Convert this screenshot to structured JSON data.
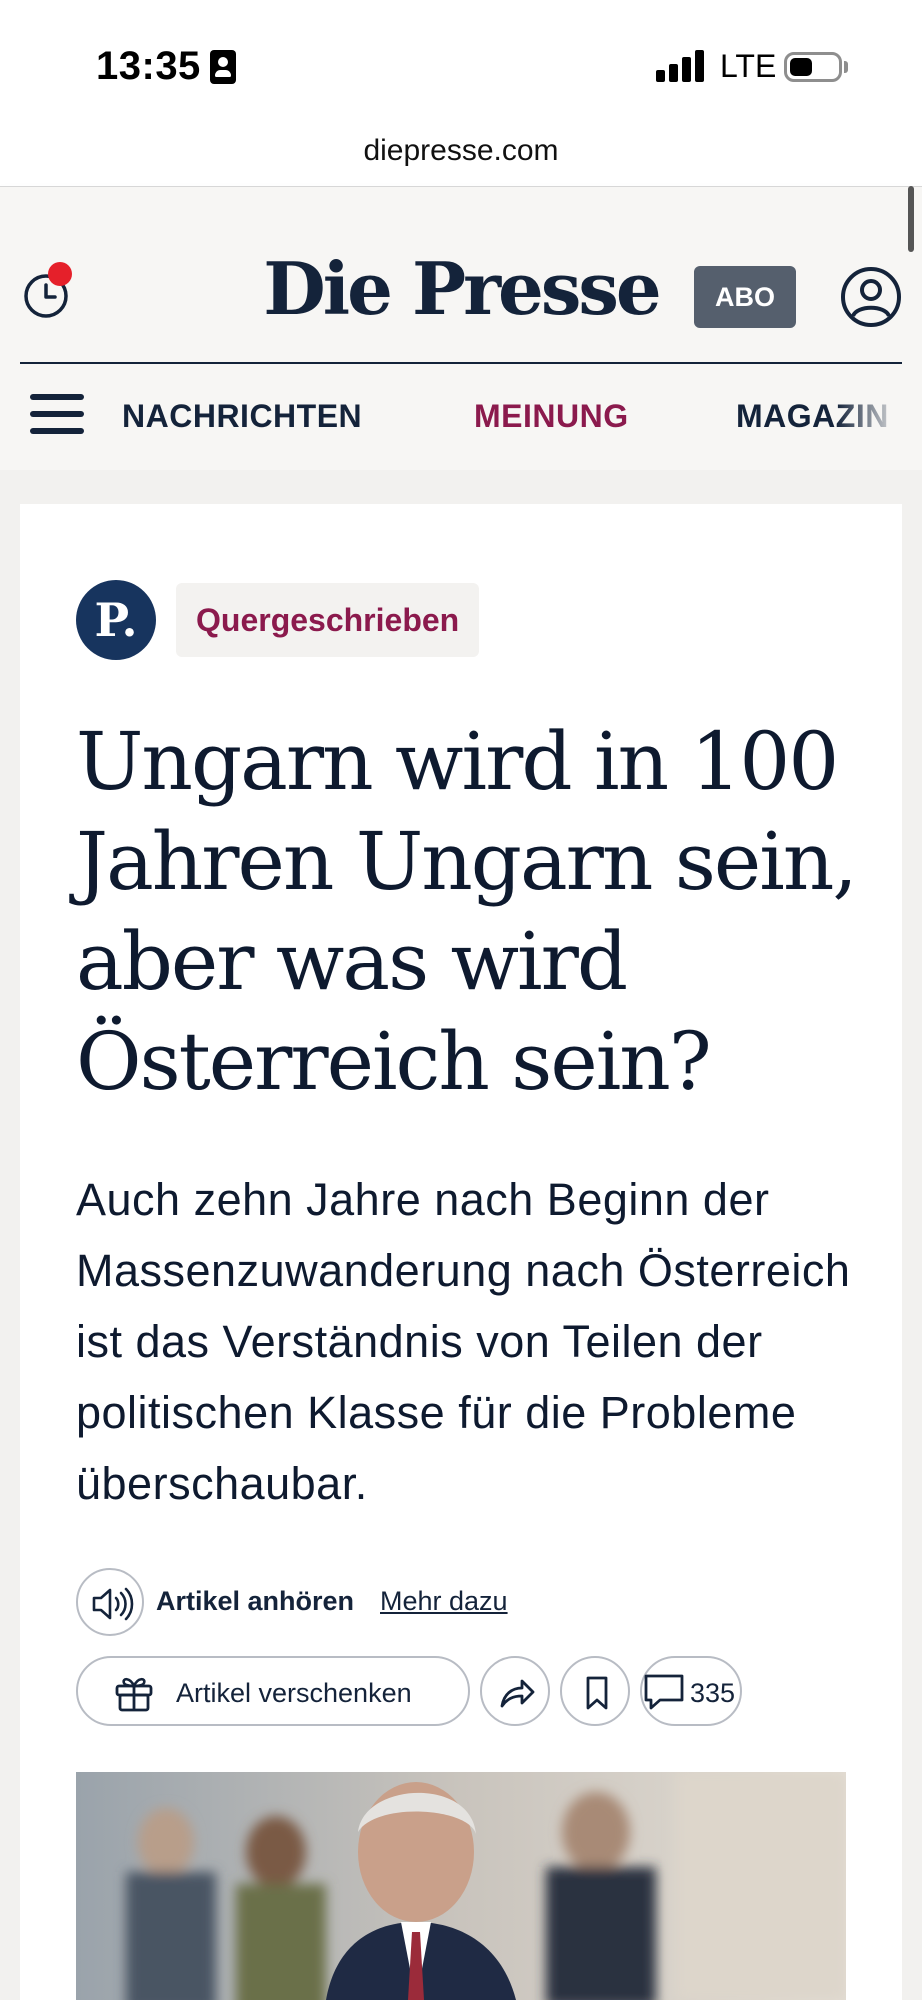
{
  "status_bar": {
    "time": "13:35",
    "network": "LTE"
  },
  "browser": {
    "url": "diepresse.com"
  },
  "header": {
    "logo": "Die Presse",
    "abo_label": "ABO",
    "nav": {
      "news": "NACHRICHTEN",
      "opinion": "MEINUNG",
      "magazin": "MAGAZIN"
    }
  },
  "article": {
    "badge": "P.",
    "category": "Quergeschrieben",
    "headline": "Ungarn wird in 100 Jahren Ungarn sein, aber was wird Österreich sein?",
    "lead": "Auch zehn Jahre nach Beginn der Massenzuwanderung nach Österreich ist das Verständnis von Teilen der politischen Klasse für die Probleme überschaubar.",
    "audio_label": "Artikel anhören",
    "more_link": "Mehr dazu",
    "gift_label": "Artikel verschenken",
    "comment_count": "335"
  },
  "icons": {
    "history": "clock-icon",
    "account": "user-circle-icon",
    "menu": "hamburger-icon",
    "audio": "speaker-icon",
    "gift": "gift-icon",
    "share": "share-arrow-icon",
    "bookmark": "bookmark-icon",
    "comments": "speech-bubble-icon"
  },
  "colors": {
    "brand_navy": "#14233a",
    "opinion_accent": "#8b1a4d",
    "abo_button": "#555f6d",
    "notification": "#e5202a"
  }
}
